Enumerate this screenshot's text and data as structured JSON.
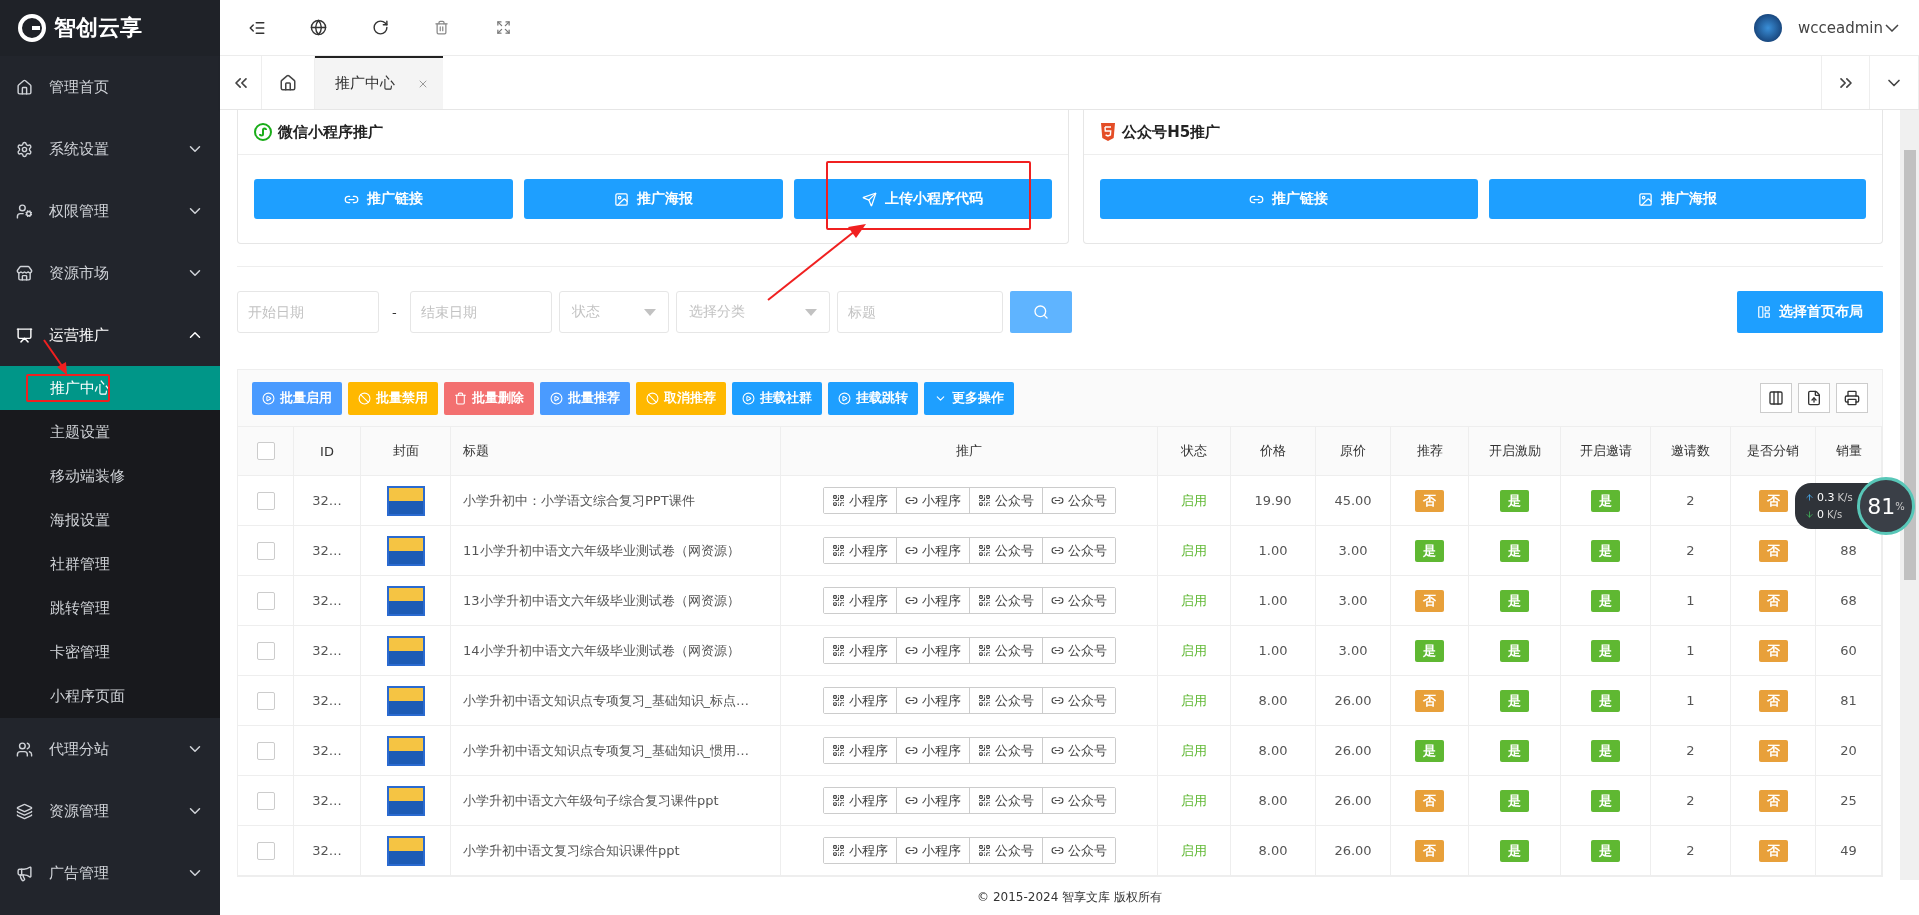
{
  "sidebar": {
    "logo": "智创云享",
    "items": [
      {
        "label": "管理首页"
      },
      {
        "label": "系统设置",
        "expanded": false
      },
      {
        "label": "权限管理",
        "expanded": false
      },
      {
        "label": "资源市场",
        "expanded": false
      },
      {
        "label": "运营推广",
        "expanded": true,
        "children": [
          {
            "label": "推广中心",
            "selected": true
          },
          {
            "label": "主题设置",
            "selected": false
          },
          {
            "label": "移动端装修",
            "selected": false
          },
          {
            "label": "海报设置",
            "selected": false
          },
          {
            "label": "社群管理",
            "selected": false
          },
          {
            "label": "跳转管理",
            "selected": false
          },
          {
            "label": "卡密管理",
            "selected": false
          },
          {
            "label": "小程序页面",
            "selected": false
          }
        ]
      },
      {
        "label": "代理分站",
        "expanded": false
      },
      {
        "label": "资源管理",
        "expanded": false
      },
      {
        "label": "广告管理",
        "expanded": false
      }
    ]
  },
  "header": {
    "username": "wcceadmin"
  },
  "tabs": [
    {
      "label": "推广中心",
      "selected": true
    }
  ],
  "promo_cards": [
    {
      "title": "微信小程序推广",
      "buttons": [
        {
          "label": "推广链接",
          "highlighted": false
        },
        {
          "label": "推广海报",
          "highlighted": false
        },
        {
          "label": "上传小程序代码",
          "highlighted": true
        }
      ]
    },
    {
      "title": "公众号H5推广",
      "buttons": [
        {
          "label": "推广链接",
          "highlighted": false
        },
        {
          "label": "推广海报",
          "highlighted": false
        }
      ]
    }
  ],
  "filters": {
    "start_date": {
      "placeholder": "开始日期"
    },
    "separator": "-",
    "end_date": {
      "placeholder": "结束日期"
    },
    "status": {
      "placeholder": "状态"
    },
    "category": {
      "placeholder": "选择分类"
    },
    "title": {
      "placeholder": "标题"
    }
  },
  "layout_button": "选择首页布局",
  "toolbar": [
    {
      "label": "批量启用",
      "color": "#4a9bff"
    },
    {
      "label": "批量禁用",
      "color": "#ffb800"
    },
    {
      "label": "批量删除",
      "color": "#f37070"
    },
    {
      "label": "批量推荐",
      "color": "#4a9bff"
    },
    {
      "label": "取消推荐",
      "color": "#ffb800"
    },
    {
      "label": "挂载社群",
      "color": "#1e9fff"
    },
    {
      "label": "挂载跳转",
      "color": "#1e9fff"
    },
    {
      "label": "更多操作",
      "color": "#1e9fff"
    }
  ],
  "table": {
    "select_all_checked": false,
    "columns": [
      "ID",
      "封面",
      "标题",
      "推广",
      "状态",
      "价格",
      "原价",
      "推荐",
      "开启激励",
      "开启邀请",
      "邀请数",
      "是否分销",
      "销量"
    ],
    "rows": [
      {
        "checked": false,
        "id": "32…",
        "title": "小学升初中：小学语文综合复习PPT课件",
        "promo": [
          {
            "kind": "qr",
            "label": "小程序"
          },
          {
            "kind": "link",
            "label": "小程序"
          },
          {
            "kind": "qr",
            "label": "公众号"
          },
          {
            "kind": "link",
            "label": "公众号"
          }
        ],
        "status": "启用",
        "price": "19.90",
        "original": "45.00",
        "recommend": {
          "label": "否",
          "on": false
        },
        "incentive": {
          "label": "是",
          "on": true
        },
        "invite": {
          "label": "是",
          "on": true
        },
        "invites": "2",
        "distribution": {
          "label": "否",
          "on": false
        }
      },
      {
        "checked": false,
        "id": "32…",
        "title": "11小学升初中语文六年级毕业测试卷（网资源）",
        "promo": [
          {
            "kind": "qr",
            "label": "小程序"
          },
          {
            "kind": "link",
            "label": "小程序"
          },
          {
            "kind": "qr",
            "label": "公众号"
          },
          {
            "kind": "link",
            "label": "公众号"
          }
        ],
        "status": "启用",
        "price": "1.00",
        "original": "3.00",
        "recommend": {
          "label": "是",
          "on": true
        },
        "incentive": {
          "label": "是",
          "on": true
        },
        "invite": {
          "label": "是",
          "on": true
        },
        "invites": "2",
        "distribution": {
          "label": "否",
          "on": false
        },
        "sales": "88"
      },
      {
        "checked": false,
        "id": "32…",
        "title": "13小学升初中语文六年级毕业测试卷（网资源）",
        "promo": [
          {
            "kind": "qr",
            "label": "小程序"
          },
          {
            "kind": "link",
            "label": "小程序"
          },
          {
            "kind": "qr",
            "label": "公众号"
          },
          {
            "kind": "link",
            "label": "公众号"
          }
        ],
        "status": "启用",
        "price": "1.00",
        "original": "3.00",
        "recommend": {
          "label": "否",
          "on": false
        },
        "incentive": {
          "label": "是",
          "on": true
        },
        "invite": {
          "label": "是",
          "on": true
        },
        "invites": "1",
        "distribution": {
          "label": "否",
          "on": false
        },
        "sales": "68"
      },
      {
        "checked": false,
        "id": "32…",
        "title": "14小学升初中语文六年级毕业测试卷（网资源）",
        "promo": [
          {
            "kind": "qr",
            "label": "小程序"
          },
          {
            "kind": "link",
            "label": "小程序"
          },
          {
            "kind": "qr",
            "label": "公众号"
          },
          {
            "kind": "link",
            "label": "公众号"
          }
        ],
        "status": "启用",
        "price": "1.00",
        "original": "3.00",
        "recommend": {
          "label": "是",
          "on": true
        },
        "incentive": {
          "label": "是",
          "on": true
        },
        "invite": {
          "label": "是",
          "on": true
        },
        "invites": "1",
        "distribution": {
          "label": "否",
          "on": false
        },
        "sales": "60"
      },
      {
        "checked": false,
        "id": "32…",
        "title": "小学升初中语文知识点专项复习_基础知识_标点…",
        "promo": [
          {
            "kind": "qr",
            "label": "小程序"
          },
          {
            "kind": "link",
            "label": "小程序"
          },
          {
            "kind": "qr",
            "label": "公众号"
          },
          {
            "kind": "link",
            "label": "公众号"
          }
        ],
        "status": "启用",
        "price": "8.00",
        "original": "26.00",
        "recommend": {
          "label": "否",
          "on": false
        },
        "incentive": {
          "label": "是",
          "on": true
        },
        "invite": {
          "label": "是",
          "on": true
        },
        "invites": "1",
        "distribution": {
          "label": "否",
          "on": false
        },
        "sales": "81"
      },
      {
        "checked": false,
        "id": "32…",
        "title": "小学升初中语文知识点专项复习_基础知识_惯用…",
        "promo": [
          {
            "kind": "qr",
            "label": "小程序"
          },
          {
            "kind": "link",
            "label": "小程序"
          },
          {
            "kind": "qr",
            "label": "公众号"
          },
          {
            "kind": "link",
            "label": "公众号"
          }
        ],
        "status": "启用",
        "price": "8.00",
        "original": "26.00",
        "recommend": {
          "label": "是",
          "on": true
        },
        "incentive": {
          "label": "是",
          "on": true
        },
        "invite": {
          "label": "是",
          "on": true
        },
        "invites": "2",
        "distribution": {
          "label": "否",
          "on": false
        },
        "sales": "20"
      },
      {
        "checked": false,
        "id": "32…",
        "title": "小学升初中语文六年级句子综合复习课件ppt",
        "promo": [
          {
            "kind": "qr",
            "label": "小程序"
          },
          {
            "kind": "link",
            "label": "小程序"
          },
          {
            "kind": "qr",
            "label": "公众号"
          },
          {
            "kind": "link",
            "label": "公众号"
          }
        ],
        "status": "启用",
        "price": "8.00",
        "original": "26.00",
        "recommend": {
          "label": "否",
          "on": false
        },
        "incentive": {
          "label": "是",
          "on": true
        },
        "invite": {
          "label": "是",
          "on": true
        },
        "invites": "2",
        "distribution": {
          "label": "否",
          "on": false
        },
        "sales": "25"
      },
      {
        "checked": false,
        "id": "32…",
        "title": "小学升初中语文复习综合知识课件ppt",
        "promo": [
          {
            "kind": "qr",
            "label": "小程序"
          },
          {
            "kind": "link",
            "label": "小程序"
          },
          {
            "kind": "qr",
            "label": "公众号"
          },
          {
            "kind": "link",
            "label": "公众号"
          }
        ],
        "status": "启用",
        "price": "8.00",
        "original": "26.00",
        "recommend": {
          "label": "否",
          "on": false
        },
        "incentive": {
          "label": "是",
          "on": true
        },
        "invite": {
          "label": "是",
          "on": true
        },
        "invites": "2",
        "distribution": {
          "label": "否",
          "on": false
        },
        "sales": "49"
      }
    ]
  },
  "footer": "© 2015-2024 智享文库 版权所有",
  "net_widget": {
    "upload": "0.3",
    "upload_unit": "K/s",
    "download": "0",
    "download_unit": "K/s",
    "percent": "81",
    "percent_sign": "%"
  }
}
